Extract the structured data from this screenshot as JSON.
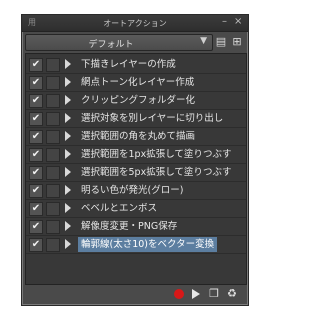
{
  "window": {
    "left_label": "用",
    "title": "オートアクション",
    "collapse_glyph": "–",
    "close_glyph": "×"
  },
  "set_selector": {
    "value": "デフォルト",
    "arrow_glyph": "▼"
  },
  "toolbar": {
    "folder_icon": "folder-menu-icon",
    "folder_glyph": "▤",
    "settings_icon": "sliders-icon",
    "settings_glyph": "⊞"
  },
  "actions": [
    {
      "label": "下描きレイヤーの作成",
      "checked": true,
      "selected": false
    },
    {
      "label": "網点トーン化レイヤー作成",
      "checked": true,
      "selected": false
    },
    {
      "label": "クリッピングフォルダー化",
      "checked": true,
      "selected": false
    },
    {
      "label": "選択対象を別レイヤーに切り出し",
      "checked": true,
      "selected": false
    },
    {
      "label": "選択範囲の角を丸めて描画",
      "checked": true,
      "selected": false
    },
    {
      "label": "選択範囲を1px拡張して塗りつぶす",
      "checked": true,
      "selected": false
    },
    {
      "label": "選択範囲を5px拡張して塗りつぶす",
      "checked": true,
      "selected": false
    },
    {
      "label": "明るい色が発光(グロー)",
      "checked": true,
      "selected": false
    },
    {
      "label": "ベベルとエンボス",
      "checked": true,
      "selected": false
    },
    {
      "label": "解像度変更・PNG保存",
      "checked": true,
      "selected": false
    },
    {
      "label": "輪郭線(太さ10)をベクター変換",
      "checked": true,
      "selected": true
    }
  ],
  "check_glyph": "✔",
  "footer": {
    "record_icon": "record-icon",
    "play_icon": "play-icon",
    "new_icon": "new-action-icon",
    "new_glyph": "❐",
    "delete_icon": "trash-icon",
    "delete_glyph": "♻"
  },
  "colors": {
    "panel_bg": "#4a4a4a",
    "list_bg": "#383838",
    "selection": "#5c7ea0",
    "record": "#d81818"
  }
}
